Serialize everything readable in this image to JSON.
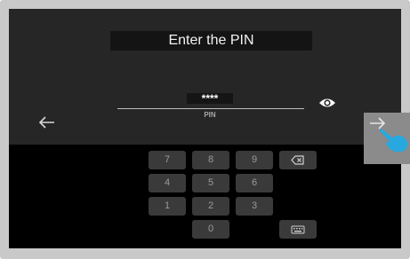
{
  "title": "Enter the PIN",
  "pin": {
    "value": "****",
    "label": "PIN"
  },
  "keypad": {
    "row1": [
      "7",
      "8",
      "9"
    ],
    "row2": [
      "4",
      "5",
      "6"
    ],
    "row3": [
      "1",
      "2",
      "3"
    ],
    "zero": "0"
  },
  "icons": {
    "back": "arrow-left-icon",
    "next": "arrow-right-icon",
    "show_pin": "eye-icon",
    "backspace": "backspace-icon",
    "keyboard": "keyboard-icon",
    "touch": "hand-pointer-icon"
  },
  "colors": {
    "screen_background": "#000000",
    "panel_background": "#262626",
    "key_background": "#3a3a3a",
    "touch_accent": "#29a8e0"
  }
}
